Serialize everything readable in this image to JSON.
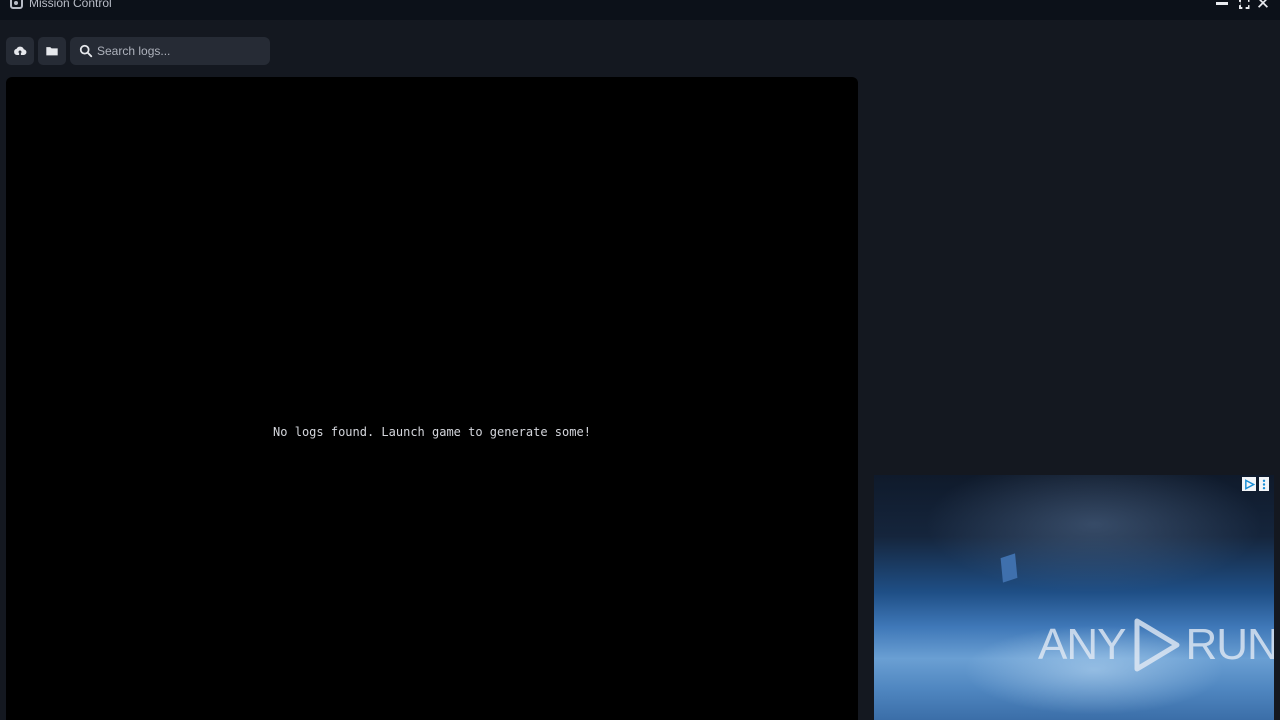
{
  "window": {
    "title": "Mission Control",
    "controls": [
      "minimize-icon",
      "maximize-icon",
      "close-icon"
    ]
  },
  "toolbar": {
    "upload_icon": "upload-cloud-icon",
    "folder_icon": "folder-icon",
    "search": {
      "placeholder": "Search logs...",
      "value": ""
    }
  },
  "logs": {
    "empty_message": "No logs found. Launch game to generate some!"
  },
  "ad": {
    "badge_icon": "ad-choices-icon",
    "watermark_left": "ANY",
    "watermark_right": "RUN"
  },
  "colors": {
    "background": "#141820",
    "titlebar": "#0c1119",
    "panel": "#000000",
    "button": "#262b35"
  }
}
